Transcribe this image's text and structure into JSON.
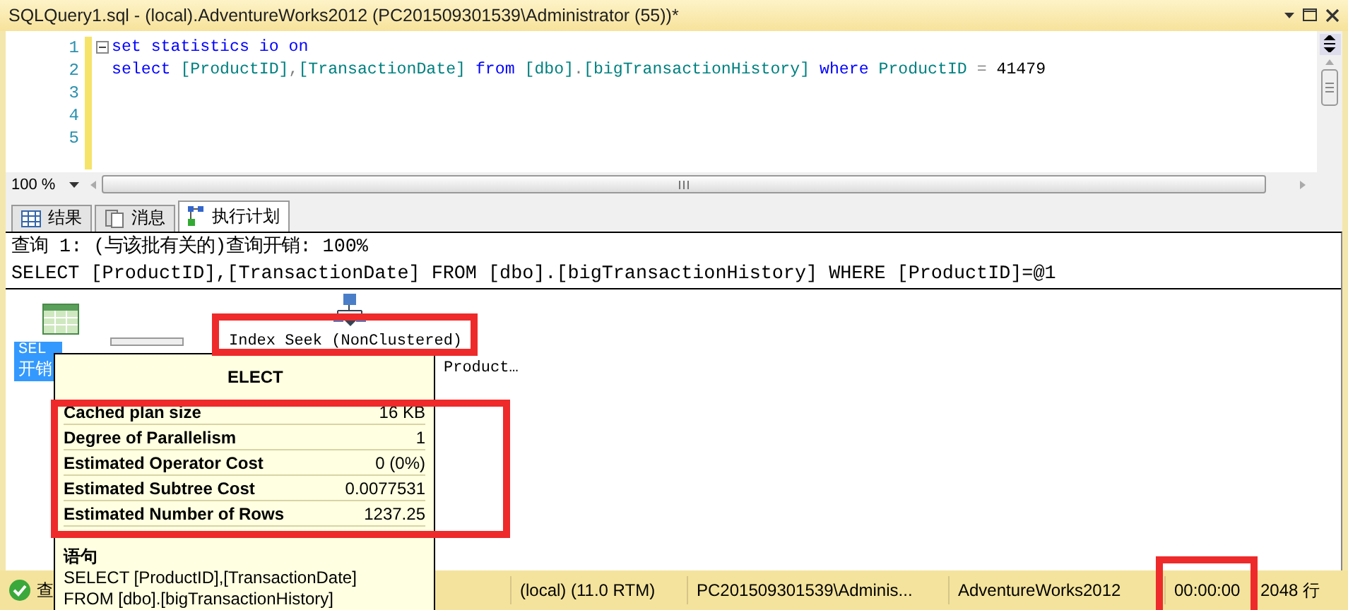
{
  "window": {
    "title": "SQLQuery1.sql - (local).AdventureWorks2012 (PC201509301539\\Administrator (55))*"
  },
  "editor": {
    "lines": [
      {
        "number": "1",
        "foldable": true,
        "tokens": [
          {
            "kind": "keyword",
            "text": "set statistics io on"
          }
        ]
      },
      {
        "number": "2",
        "tokens": [
          {
            "kind": "keyword",
            "text": "select"
          },
          {
            "kind": "ident",
            "text": " [ProductID]"
          },
          {
            "kind": "operator",
            "text": ","
          },
          {
            "kind": "ident",
            "text": "[TransactionDate]"
          },
          {
            "kind": "keyword",
            "text": " from"
          },
          {
            "kind": "ident",
            "text": " [dbo]"
          },
          {
            "kind": "operator",
            "text": "."
          },
          {
            "kind": "ident",
            "text": "[bigTransactionHistory]"
          },
          {
            "kind": "keyword",
            "text": " where"
          },
          {
            "kind": "ident",
            "text": " ProductID"
          },
          {
            "kind": "operator",
            "text": " = "
          },
          {
            "kind": "plain",
            "text": "41479"
          }
        ]
      },
      {
        "number": "3"
      },
      {
        "number": "4"
      },
      {
        "number": "5"
      }
    ]
  },
  "zoom": {
    "value": "100 %"
  },
  "tabs": [
    {
      "label": "结果",
      "selected": false
    },
    {
      "label": "消息",
      "selected": false
    },
    {
      "label": "执行计划",
      "selected": true
    }
  ],
  "plan": {
    "header": [
      "查询 1: (与该批有关的)查询开销: 100%",
      "SELECT [ProductID],[TransactionDate] FROM [dbo].[bigTransactionHistory] WHERE [ProductID]=@1"
    ],
    "nodes": [
      {
        "kind": "select",
        "label": "SEL",
        "cost": "开销",
        "selected": true
      },
      {
        "kind": "index_seek",
        "label": "Index Seek (NonClustered)",
        "object": "Product…",
        "selected": false
      }
    ]
  },
  "tooltip": {
    "title": "ELECT",
    "rows": [
      {
        "name": "Cached plan size",
        "value": "16 KB"
      },
      {
        "name": "Degree of Parallelism",
        "value": "1"
      },
      {
        "name": "Estimated Operator Cost",
        "value": "0 (0%)"
      },
      {
        "name": "Estimated Subtree Cost",
        "value": "0.0077531"
      },
      {
        "name": "Estimated Number of Rows",
        "value": "1237.25"
      }
    ],
    "section": "语句",
    "statement": [
      "SELECT [ProductID],[TransactionDate]",
      "FROM [dbo].[bigTransactionHistory]"
    ]
  },
  "status_bar": {
    "message": "查",
    "items": [
      "(local) (11.0 RTM)",
      "PC201509301539\\Adminis...",
      "AdventureWorks2012",
      "00:00:00",
      "2048 行"
    ]
  }
}
